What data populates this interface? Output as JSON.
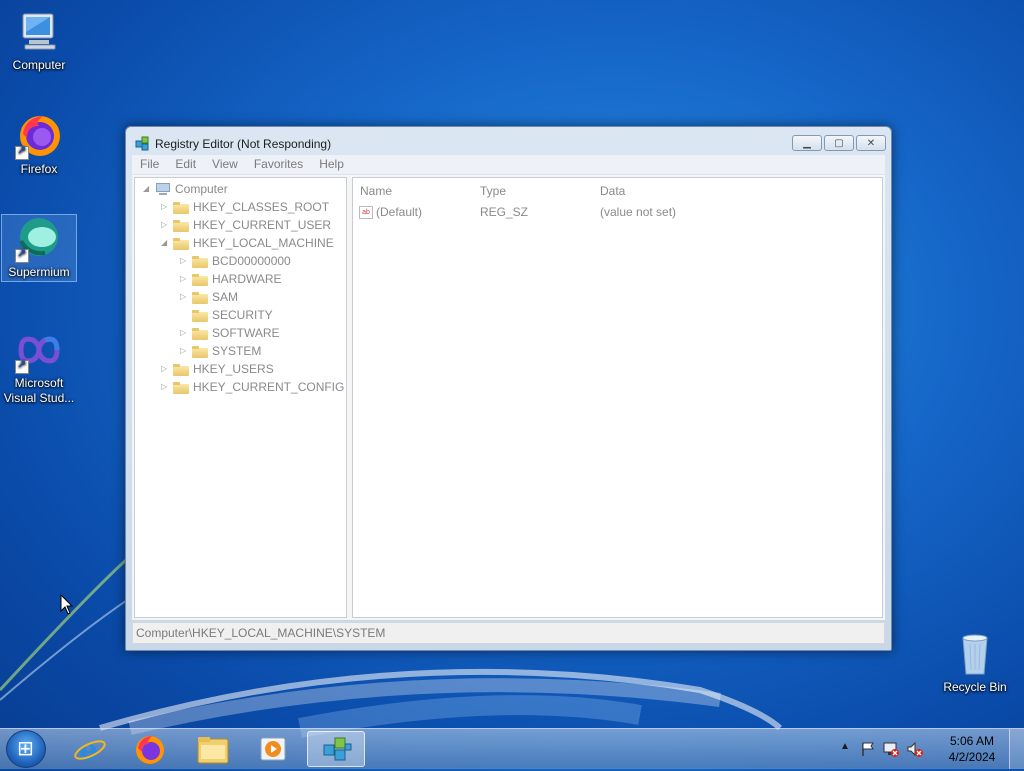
{
  "desktop": {
    "icons": [
      {
        "label": "Computer"
      },
      {
        "label": "Firefox"
      },
      {
        "label": "Supermium"
      },
      {
        "label": "Microsoft Visual Stud..."
      },
      {
        "label": "Recycle Bin"
      }
    ]
  },
  "window": {
    "title": "Registry Editor (Not Responding)",
    "menu": [
      "File",
      "Edit",
      "View",
      "Favorites",
      "Help"
    ],
    "tree": {
      "root": "Computer",
      "hives": [
        "HKEY_CLASSES_ROOT",
        "HKEY_CURRENT_USER",
        "HKEY_LOCAL_MACHINE",
        "HKEY_USERS",
        "HKEY_CURRENT_CONFIG"
      ],
      "hklm_children": [
        "BCD00000000",
        "HARDWARE",
        "SAM",
        "SECURITY",
        "SOFTWARE",
        "SYSTEM"
      ]
    },
    "list": {
      "columns": [
        "Name",
        "Type",
        "Data"
      ],
      "rows": [
        {
          "name": "(Default)",
          "type": "REG_SZ",
          "data": "(value not set)",
          "icon": "ab"
        }
      ]
    },
    "status": "Computer\\HKEY_LOCAL_MACHINE\\SYSTEM"
  },
  "taskbar": {
    "time": "5:06 AM",
    "date": "4/2/2024"
  }
}
